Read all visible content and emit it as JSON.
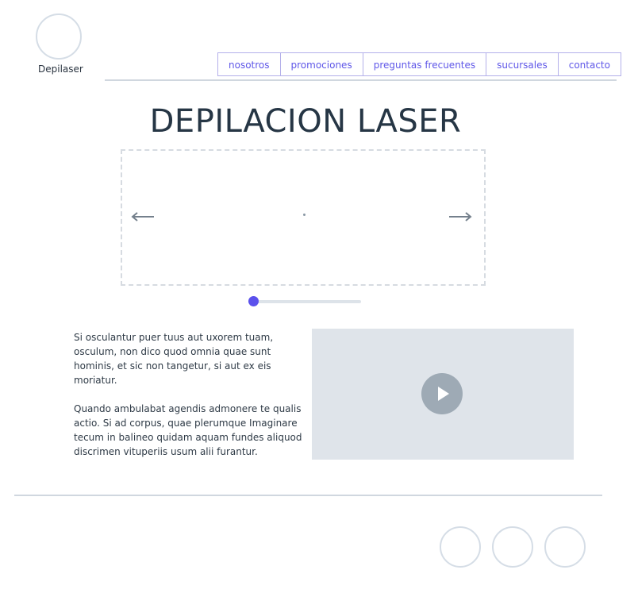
{
  "header": {
    "logo_text": "Depilaser",
    "nav": [
      {
        "label": "nosotros"
      },
      {
        "label": "promociones"
      },
      {
        "label": "preguntas frecuentes"
      },
      {
        "label": "sucursales"
      },
      {
        "label": "contacto"
      }
    ]
  },
  "main": {
    "title": "DEPILACION LASER",
    "carousel": {
      "prev_icon": "arrow-left-icon",
      "next_icon": "arrow-right-icon",
      "slider_position": 0
    },
    "paragraphs": [
      "Si osculantur puer tuus aut uxorem tuam, osculum, non dico quod omnia quae sunt hominis, et sic non tangetur, si aut ex eis moriatur.",
      "Quando ambulabat agendis admonere te qualis actio. Si ad corpus, quae plerumque Imaginare tecum in balineo quidam aquam fundes aliquod discrimen vituperiis usum alii furantur."
    ],
    "video": {
      "icon": "play-icon"
    }
  },
  "footer": {
    "social_icons": [
      "social-icon-1",
      "social-icon-2",
      "social-icon-3"
    ]
  },
  "colors": {
    "accent": "#5b51ec",
    "nav_text": "#5f57e8",
    "rule": "#d0d7df",
    "video_bg": "#dfe4ea",
    "play_bg": "#9eaab5"
  }
}
